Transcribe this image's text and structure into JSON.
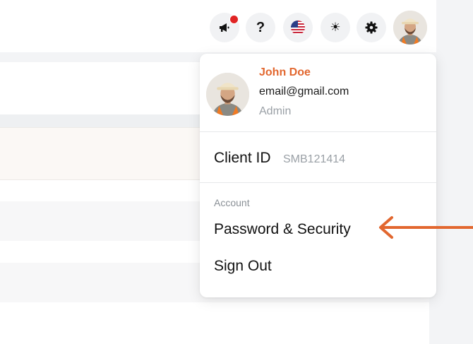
{
  "header": {
    "icons": [
      {
        "name": "megaphone-icon"
      },
      {
        "name": "help-icon",
        "glyph": "?"
      },
      {
        "name": "us-flag-icon"
      },
      {
        "name": "brightness-icon",
        "glyph": "☀"
      },
      {
        "name": "gear-icon"
      }
    ],
    "notification_color": "#e02424"
  },
  "profile": {
    "name": "John Doe",
    "email": "email@gmail.com",
    "role": "Admin"
  },
  "client": {
    "label": "Client ID",
    "value": "SMB121414"
  },
  "account_menu": {
    "section_label": "Account",
    "items": [
      "Password & Security",
      "Sign Out"
    ]
  },
  "colors": {
    "accent": "#e2672f",
    "arrow": "#e2672f"
  }
}
